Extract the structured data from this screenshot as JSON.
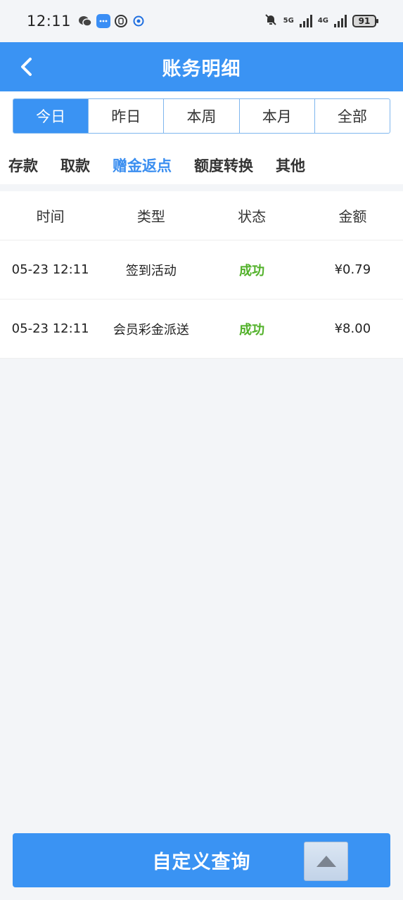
{
  "status_bar": {
    "time": "12:11",
    "net1": "5G",
    "net2": "4G",
    "battery": "91"
  },
  "header": {
    "title": "账务明细"
  },
  "period_tabs": [
    {
      "label": "今日",
      "active": true
    },
    {
      "label": "昨日",
      "active": false
    },
    {
      "label": "本周",
      "active": false
    },
    {
      "label": "本月",
      "active": false
    },
    {
      "label": "全部",
      "active": false
    }
  ],
  "category_tabs": [
    {
      "label": "存款",
      "active": false
    },
    {
      "label": "取款",
      "active": false
    },
    {
      "label": "赠金返点",
      "active": true
    },
    {
      "label": "额度转换",
      "active": false
    },
    {
      "label": "其他",
      "active": false
    }
  ],
  "table": {
    "headers": [
      "时间",
      "类型",
      "状态",
      "金额"
    ],
    "rows": [
      {
        "time": "05-23 12:11",
        "type": "签到活动",
        "status": "成功",
        "amount": "¥0.79"
      },
      {
        "time": "05-23 12:11",
        "type": "会员彩金派送",
        "status": "成功",
        "amount": "¥8.00"
      }
    ]
  },
  "footer": {
    "query_label": "自定义查询"
  },
  "colors": {
    "brand": "#3a93f3",
    "active_category": "#3a8ef0",
    "success": "#52b12a"
  },
  "icons": {
    "back": "chevron-left-icon",
    "scroll_top": "triangle-up-icon"
  }
}
